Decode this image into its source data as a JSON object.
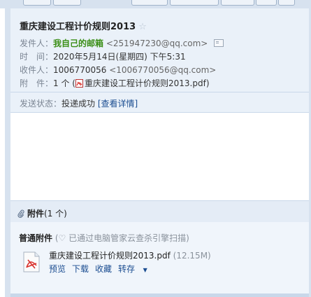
{
  "email": {
    "subject": "重庆建设工程计价规则2013",
    "sender_label": "发件人：",
    "sender_name": "我自己的邮箱",
    "sender_addr": "<251947230@qq.com>",
    "time_label": "时　间：",
    "time_value": "2020年5月14日(星期四) 下午5:31",
    "to_label": "收件人：",
    "to_name": "1006770056",
    "to_addr": "<1006770056@qq.com>",
    "attach_label": "附　件：",
    "attach_count": "1 个",
    "attach_file": "重庆建设工程计价规则2013.pdf",
    "status_label": "发送状态：",
    "status_value": "投递成功",
    "status_link": "[查看详情]"
  },
  "attachments": {
    "title": "附件",
    "count": "(1 个)",
    "normal_label": "普通附件",
    "scan_note": "(♡ 已通过电脑管家云查杀引擎扫描)",
    "file_name": "重庆建设工程计价规则2013.pdf",
    "file_size": "(12.15M)",
    "actions": {
      "preview": "预览",
      "download": "下载",
      "favorite": "收藏",
      "transfer": "转存"
    }
  },
  "colors": {
    "header_bg": "#eaf1f9",
    "sender_green": "#3a8e16",
    "link_blue": "#1b4d91",
    "pdf_red": "#d9302b"
  }
}
